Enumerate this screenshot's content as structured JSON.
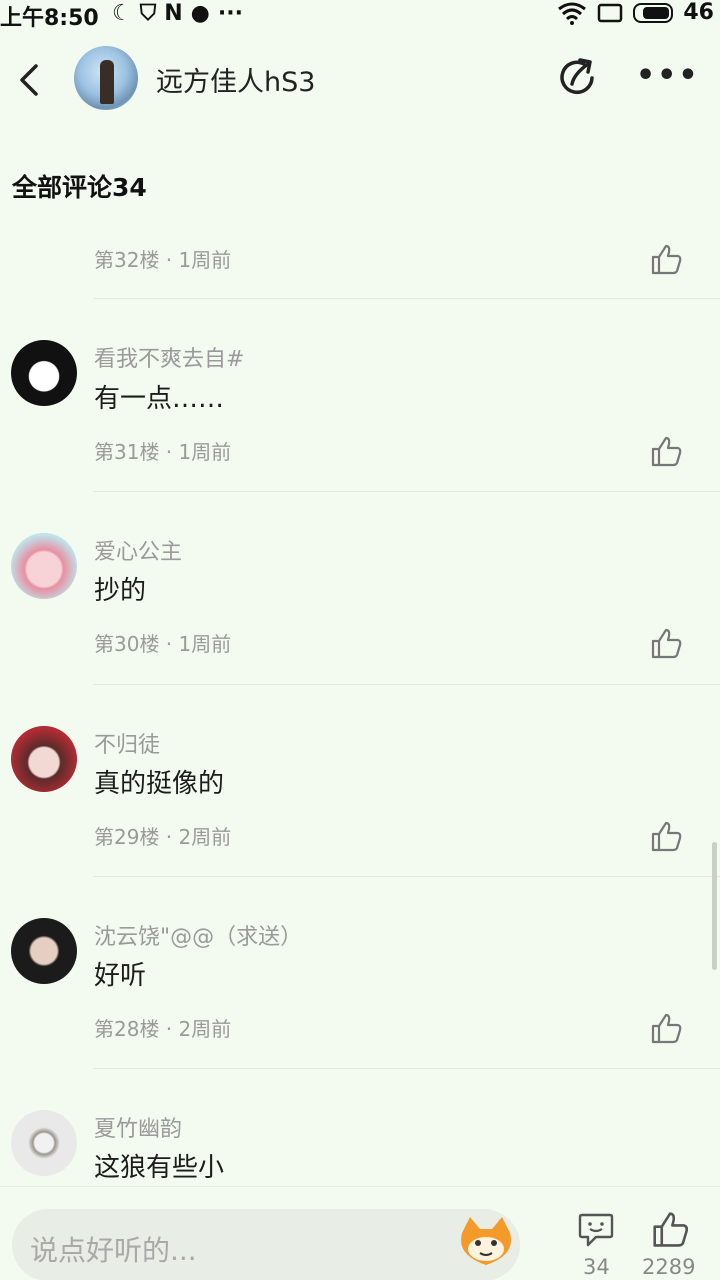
{
  "status": {
    "time": "上午8:50",
    "battery": "46"
  },
  "header": {
    "username": "远方佳人hS3"
  },
  "section_title": "全部评论34",
  "comments": [
    {
      "name": "",
      "text": "",
      "meta": "第32楼 · 1周前"
    },
    {
      "name": "看我不爽去自#",
      "text": "有一点……",
      "meta": "第31楼 · 1周前"
    },
    {
      "name": "爱心公主",
      "text": "抄的",
      "meta": "第30楼 · 1周前"
    },
    {
      "name": "不归徒",
      "text": "真的挺像的",
      "meta": "第29楼 · 2周前"
    },
    {
      "name": "沈云饶\"@@（求送）",
      "text": "好听",
      "meta": "第28楼 · 2周前"
    },
    {
      "name": "夏竹幽韵",
      "text": "这狼有些小",
      "meta": ""
    }
  ],
  "bottom": {
    "placeholder": "说点好听的...",
    "comment_count": "34",
    "like_count": "2289"
  }
}
